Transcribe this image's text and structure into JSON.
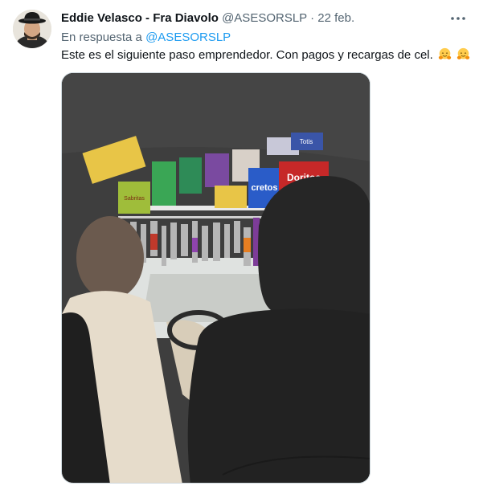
{
  "tweet": {
    "display_name": "Eddie Velasco - Fra Diavolo",
    "handle": "@ASESORSLP",
    "separator": "·",
    "date": "22 feb.",
    "reply_prefix": "En respuesta a",
    "reply_to": "@ASESORSLP",
    "text": "Este es el siguiente paso emprendedor.  Con pagos y recargas de cel.",
    "emoji": [
      "hugging-face",
      "hugging-face"
    ],
    "more_icon": "ellipsis-icon"
  },
  "photo": {
    "snack_labels": [
      "Sabritas",
      "cretos",
      "Doritos",
      "Totis"
    ]
  },
  "colors": {
    "link": "#1d9bf0",
    "secondary_text": "#536471",
    "primary_text": "#0f1419",
    "border": "#cfd9de"
  }
}
